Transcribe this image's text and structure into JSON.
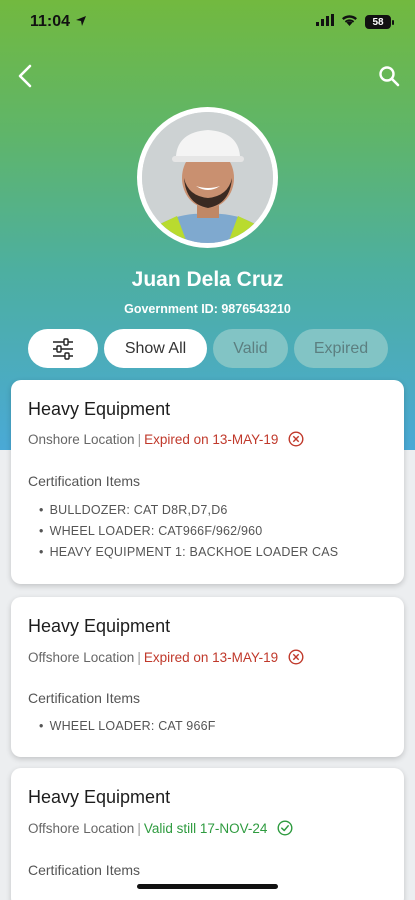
{
  "status_bar": {
    "time": "11:04",
    "battery": "58"
  },
  "profile": {
    "name": "Juan Dela Cruz",
    "government_id": "Government ID: 9876543210"
  },
  "filters": {
    "show_all": "Show All",
    "valid": "Valid",
    "expired": "Expired"
  },
  "cards": [
    {
      "title": "Heavy Equipment",
      "location": "Onshore Location",
      "separator": "|",
      "status_text": "Expired on 13-MAY-19",
      "status": "expired",
      "items_label": "Certification Items",
      "items": [
        "BULLDOZER: CAT D8R,D7,D6",
        "WHEEL LOADER: CAT966F/962/960",
        "HEAVY EQUIPMENT 1: BACKHOE LOADER CAS"
      ]
    },
    {
      "title": "Heavy Equipment",
      "location": "Offshore Location",
      "separator": "|",
      "status_text": "Expired on 13-MAY-19",
      "status": "expired",
      "items_label": "Certification Items",
      "items": [
        "WHEEL LOADER: CAT 966F"
      ]
    },
    {
      "title": "Heavy Equipment",
      "location": "Offshore Location",
      "separator": "|",
      "status_text": "Valid still 17-NOV-24",
      "status": "valid",
      "items_label": "Certification Items",
      "items": []
    }
  ],
  "colors": {
    "expired": "#c0392b",
    "valid": "#2e9b3f",
    "gradient_top": "#72b93f",
    "gradient_bottom": "#4aa9d6"
  },
  "icons": {
    "back": "chevron-left-icon",
    "search": "search-icon",
    "filter": "sliders-icon",
    "expired": "x-circle-icon",
    "valid": "check-circle-icon"
  }
}
